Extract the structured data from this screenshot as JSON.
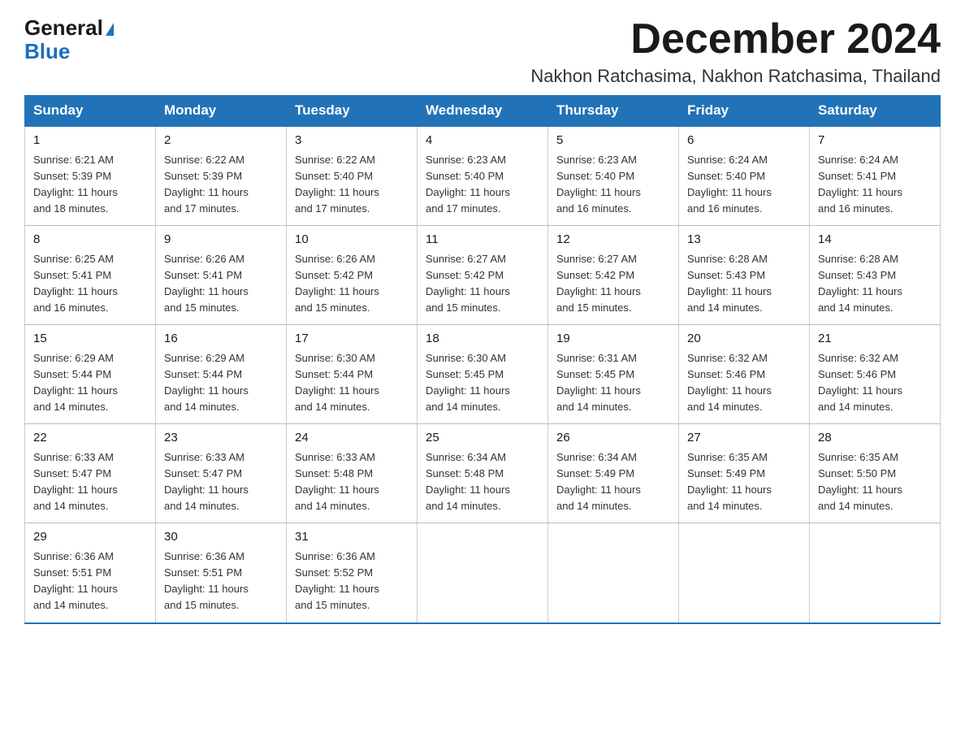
{
  "logo": {
    "general": "General",
    "blue": "Blue"
  },
  "title": "December 2024",
  "location": "Nakhon Ratchasima, Nakhon Ratchasima, Thailand",
  "days_of_week": [
    "Sunday",
    "Monday",
    "Tuesday",
    "Wednesday",
    "Thursday",
    "Friday",
    "Saturday"
  ],
  "weeks": [
    [
      {
        "day": "1",
        "sunrise": "6:21 AM",
        "sunset": "5:39 PM",
        "daylight": "11 hours and 18 minutes."
      },
      {
        "day": "2",
        "sunrise": "6:22 AM",
        "sunset": "5:39 PM",
        "daylight": "11 hours and 17 minutes."
      },
      {
        "day": "3",
        "sunrise": "6:22 AM",
        "sunset": "5:40 PM",
        "daylight": "11 hours and 17 minutes."
      },
      {
        "day": "4",
        "sunrise": "6:23 AM",
        "sunset": "5:40 PM",
        "daylight": "11 hours and 17 minutes."
      },
      {
        "day": "5",
        "sunrise": "6:23 AM",
        "sunset": "5:40 PM",
        "daylight": "11 hours and 16 minutes."
      },
      {
        "day": "6",
        "sunrise": "6:24 AM",
        "sunset": "5:40 PM",
        "daylight": "11 hours and 16 minutes."
      },
      {
        "day": "7",
        "sunrise": "6:24 AM",
        "sunset": "5:41 PM",
        "daylight": "11 hours and 16 minutes."
      }
    ],
    [
      {
        "day": "8",
        "sunrise": "6:25 AM",
        "sunset": "5:41 PM",
        "daylight": "11 hours and 16 minutes."
      },
      {
        "day": "9",
        "sunrise": "6:26 AM",
        "sunset": "5:41 PM",
        "daylight": "11 hours and 15 minutes."
      },
      {
        "day": "10",
        "sunrise": "6:26 AM",
        "sunset": "5:42 PM",
        "daylight": "11 hours and 15 minutes."
      },
      {
        "day": "11",
        "sunrise": "6:27 AM",
        "sunset": "5:42 PM",
        "daylight": "11 hours and 15 minutes."
      },
      {
        "day": "12",
        "sunrise": "6:27 AM",
        "sunset": "5:42 PM",
        "daylight": "11 hours and 15 minutes."
      },
      {
        "day": "13",
        "sunrise": "6:28 AM",
        "sunset": "5:43 PM",
        "daylight": "11 hours and 14 minutes."
      },
      {
        "day": "14",
        "sunrise": "6:28 AM",
        "sunset": "5:43 PM",
        "daylight": "11 hours and 14 minutes."
      }
    ],
    [
      {
        "day": "15",
        "sunrise": "6:29 AM",
        "sunset": "5:44 PM",
        "daylight": "11 hours and 14 minutes."
      },
      {
        "day": "16",
        "sunrise": "6:29 AM",
        "sunset": "5:44 PM",
        "daylight": "11 hours and 14 minutes."
      },
      {
        "day": "17",
        "sunrise": "6:30 AM",
        "sunset": "5:44 PM",
        "daylight": "11 hours and 14 minutes."
      },
      {
        "day": "18",
        "sunrise": "6:30 AM",
        "sunset": "5:45 PM",
        "daylight": "11 hours and 14 minutes."
      },
      {
        "day": "19",
        "sunrise": "6:31 AM",
        "sunset": "5:45 PM",
        "daylight": "11 hours and 14 minutes."
      },
      {
        "day": "20",
        "sunrise": "6:32 AM",
        "sunset": "5:46 PM",
        "daylight": "11 hours and 14 minutes."
      },
      {
        "day": "21",
        "sunrise": "6:32 AM",
        "sunset": "5:46 PM",
        "daylight": "11 hours and 14 minutes."
      }
    ],
    [
      {
        "day": "22",
        "sunrise": "6:33 AM",
        "sunset": "5:47 PM",
        "daylight": "11 hours and 14 minutes."
      },
      {
        "day": "23",
        "sunrise": "6:33 AM",
        "sunset": "5:47 PM",
        "daylight": "11 hours and 14 minutes."
      },
      {
        "day": "24",
        "sunrise": "6:33 AM",
        "sunset": "5:48 PM",
        "daylight": "11 hours and 14 minutes."
      },
      {
        "day": "25",
        "sunrise": "6:34 AM",
        "sunset": "5:48 PM",
        "daylight": "11 hours and 14 minutes."
      },
      {
        "day": "26",
        "sunrise": "6:34 AM",
        "sunset": "5:49 PM",
        "daylight": "11 hours and 14 minutes."
      },
      {
        "day": "27",
        "sunrise": "6:35 AM",
        "sunset": "5:49 PM",
        "daylight": "11 hours and 14 minutes."
      },
      {
        "day": "28",
        "sunrise": "6:35 AM",
        "sunset": "5:50 PM",
        "daylight": "11 hours and 14 minutes."
      }
    ],
    [
      {
        "day": "29",
        "sunrise": "6:36 AM",
        "sunset": "5:51 PM",
        "daylight": "11 hours and 14 minutes."
      },
      {
        "day": "30",
        "sunrise": "6:36 AM",
        "sunset": "5:51 PM",
        "daylight": "11 hours and 15 minutes."
      },
      {
        "day": "31",
        "sunrise": "6:36 AM",
        "sunset": "5:52 PM",
        "daylight": "11 hours and 15 minutes."
      },
      null,
      null,
      null,
      null
    ]
  ],
  "labels": {
    "sunrise": "Sunrise:",
    "sunset": "Sunset:",
    "daylight": "Daylight:"
  },
  "colors": {
    "header_bg": "#2272b8",
    "header_text": "#ffffff",
    "border": "#bbbbbb"
  }
}
